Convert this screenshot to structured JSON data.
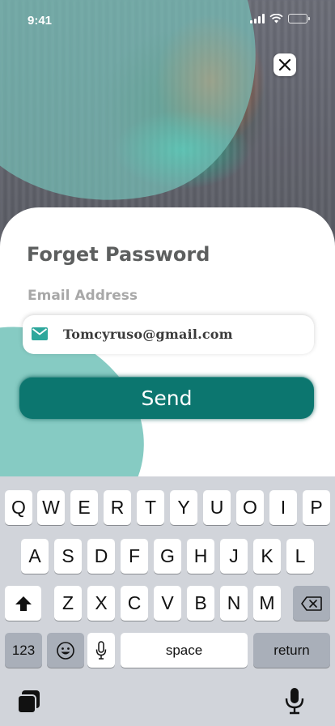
{
  "status_bar": {
    "time": "9:41"
  },
  "form": {
    "title": "Forget Password",
    "email_label": "Email Address",
    "email_value": "Tomcyruso@gmail.com",
    "send_label": "Send"
  },
  "keyboard": {
    "row1": [
      "Q",
      "W",
      "E",
      "R",
      "T",
      "Y",
      "U",
      "O",
      "I",
      "P"
    ],
    "row2": [
      "A",
      "S",
      "D",
      "F",
      "G",
      "H",
      "J",
      "K",
      "L"
    ],
    "row3": [
      "Z",
      "X",
      "C",
      "V",
      "B",
      "N",
      "M"
    ],
    "numbers_label": "123",
    "space_label": "space",
    "return_label": "return"
  },
  "colors": {
    "accent": "#0c766f",
    "blob": "#86cbc3"
  },
  "icons": [
    "close-icon",
    "mail-icon",
    "shift-icon",
    "backspace-icon",
    "emoji-icon",
    "mic-icon",
    "globe-copy-icon",
    "dictation-icon"
  ]
}
